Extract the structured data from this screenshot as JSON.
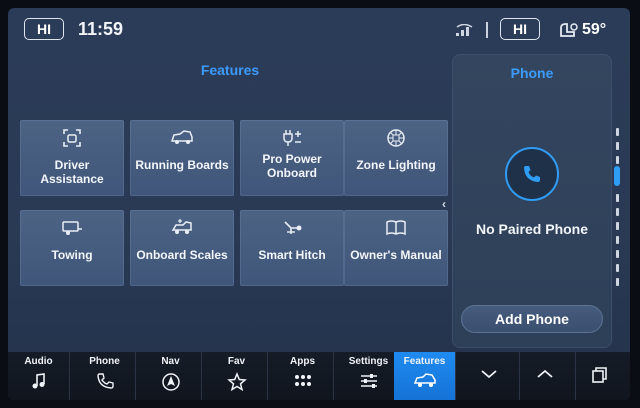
{
  "status_bar": {
    "hi_left": "HI",
    "time": "11:59",
    "hi_right": "HI",
    "temperature": "59°",
    "icons": [
      "wifi-signal-icon",
      "fan-seat-icon"
    ]
  },
  "features": {
    "title": "Features",
    "tiles": [
      {
        "label": "Driver Assistance",
        "icon": "driver-assist-icon"
      },
      {
        "label": "Running Boards",
        "icon": "running-boards-icon"
      },
      {
        "label": "Pro Power Onboard",
        "icon": "power-plug-icon"
      },
      {
        "label": "Zone Lighting",
        "icon": "zone-lighting-icon"
      },
      {
        "label": "Towing",
        "icon": "trailer-icon"
      },
      {
        "label": "Onboard Scales",
        "icon": "scales-icon"
      },
      {
        "label": "Smart Hitch",
        "icon": "hitch-icon"
      },
      {
        "label": "Owner's Manual",
        "icon": "book-icon"
      }
    ]
  },
  "phone": {
    "title": "Phone",
    "status": "No Paired Phone",
    "add_button": "Add Phone"
  },
  "bottom_nav": [
    {
      "label": "Audio",
      "icon": "music-note-icon",
      "active": false
    },
    {
      "label": "Phone",
      "icon": "phone-icon",
      "active": false
    },
    {
      "label": "Nav",
      "icon": "navigation-icon",
      "active": false
    },
    {
      "label": "Fav",
      "icon": "star-icon",
      "active": false
    },
    {
      "label": "Apps",
      "icon": "apps-grid-icon",
      "active": false
    },
    {
      "label": "Settings",
      "icon": "sliders-icon",
      "active": false
    },
    {
      "label": "Features",
      "icon": "truck-icon",
      "active": true
    },
    {
      "label": "",
      "icon": "chevron-down-icon",
      "active": false
    },
    {
      "label": "",
      "icon": "chevron-up-icon",
      "active": false
    },
    {
      "label": "",
      "icon": "multi-window-icon",
      "active": false
    }
  ],
  "colors": {
    "accent": "#2f9df5",
    "title_blue": "#3c9bff",
    "active_tab": "#1f8bf0"
  }
}
